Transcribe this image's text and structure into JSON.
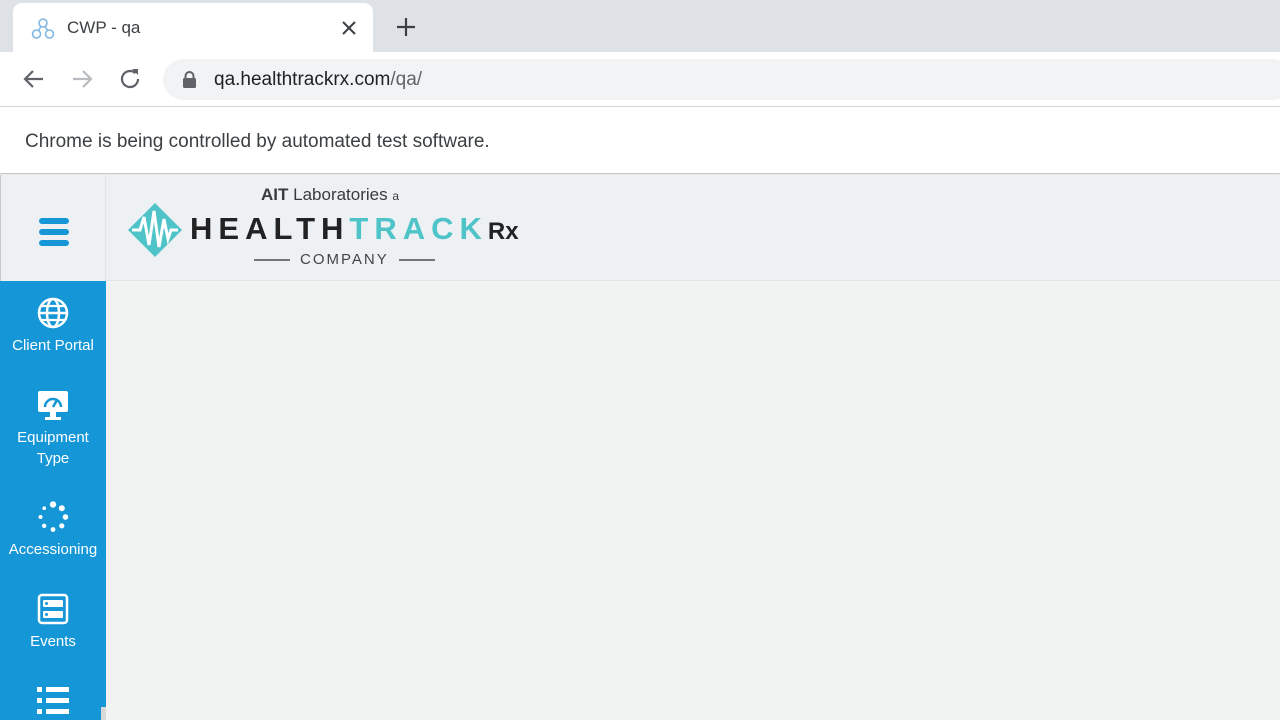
{
  "browser": {
    "tab_title": "CWP - qa",
    "url_host": "qa.healthtrackrx.com",
    "url_path": "/qa/",
    "infobar_text": "Chrome is being controlled by automated test software."
  },
  "logo": {
    "top_bold": "AIT",
    "top_light": "Laboratories",
    "top_small": "a",
    "name_dark": "HEALTH",
    "name_teal": "TRACK",
    "name_rx": "Rx",
    "company": "COMPANY",
    "teal_color": "#4ec3c8"
  },
  "sidebar": {
    "color": "#1596d6",
    "items": [
      {
        "label": "Client Portal",
        "icon": "globe-icon"
      },
      {
        "label": "Equipment Type",
        "icon": "monitor-gauge-icon"
      },
      {
        "label": "Accessioning",
        "icon": "spinner-icon"
      },
      {
        "label": "Events",
        "icon": "server-list-icon"
      },
      {
        "label": "",
        "icon": "list-icon"
      }
    ]
  }
}
